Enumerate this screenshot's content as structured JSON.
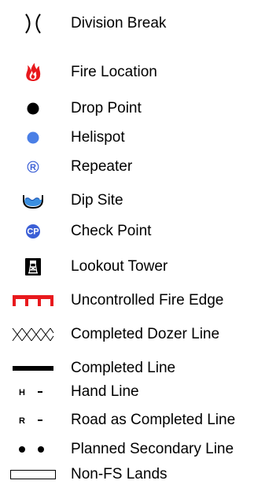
{
  "colors": {
    "fire_red": "#e8191d",
    "helispot_blue": "#4a7fe6",
    "dip_blue": "#3b8fe0",
    "text": "#000000"
  },
  "legend": {
    "items": [
      {
        "icon": "division-break-icon",
        "label": "Division Break"
      },
      {
        "icon": "fire-location-icon",
        "label": "Fire Location"
      },
      {
        "icon": "drop-point-icon",
        "label": "Drop Point"
      },
      {
        "icon": "helispot-icon",
        "label": "Helispot"
      },
      {
        "icon": "repeater-icon",
        "label": "Repeater",
        "symbol_text": "R"
      },
      {
        "icon": "dip-site-icon",
        "label": "Dip Site"
      },
      {
        "icon": "check-point-icon",
        "label": "Check Point",
        "symbol_text": "CP"
      },
      {
        "icon": "lookout-tower-icon",
        "label": "Lookout Tower"
      },
      {
        "icon": "uncontrolled-fire-edge-icon",
        "label": "Uncontrolled Fire Edge"
      },
      {
        "icon": "completed-dozer-line-icon",
        "label": "Completed Dozer Line"
      },
      {
        "icon": "completed-line-icon",
        "label": "Completed Line"
      },
      {
        "icon": "hand-line-icon",
        "label": "Hand Line",
        "symbol_text": "H"
      },
      {
        "icon": "road-as-completed-line-icon",
        "label": "Road as Completed Line",
        "symbol_text": "R"
      },
      {
        "icon": "planned-secondary-line-icon",
        "label": "Planned Secondary Line"
      },
      {
        "icon": "non-fs-lands-icon",
        "label": "Non-FS Lands"
      }
    ]
  }
}
